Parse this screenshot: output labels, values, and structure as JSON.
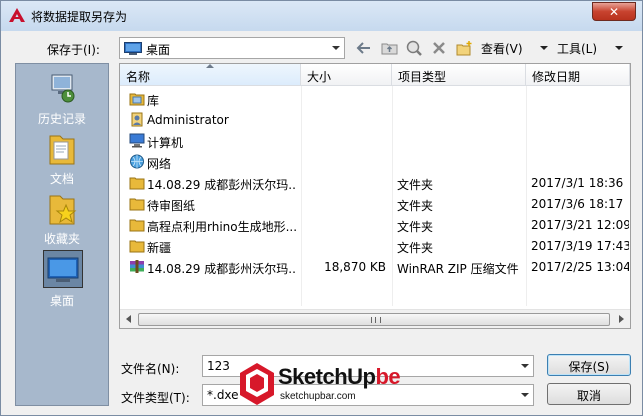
{
  "window": {
    "title": "将数据提取另存为",
    "close_label": "✕"
  },
  "location": {
    "label": "保存于(I):",
    "value": "桌面"
  },
  "toolbar": {
    "view_label": "查看(V)",
    "tools_label": "工具(L)"
  },
  "places": [
    {
      "label": "历史记录",
      "icon": "history-icon"
    },
    {
      "label": "文档",
      "icon": "documents-folder-icon"
    },
    {
      "label": "收藏夹",
      "icon": "favorites-folder-icon"
    },
    {
      "label": "桌面",
      "icon": "desktop-icon",
      "selected": true
    }
  ],
  "columns": [
    "名称",
    "大小",
    "项目类型",
    "修改日期"
  ],
  "files": [
    {
      "name": "库",
      "size": "",
      "type": "",
      "date": "",
      "icon": "library-icon"
    },
    {
      "name": "Administrator",
      "size": "",
      "type": "",
      "date": "",
      "icon": "user-icon"
    },
    {
      "name": "计算机",
      "size": "",
      "type": "",
      "date": "",
      "icon": "computer-icon"
    },
    {
      "name": "网络",
      "size": "",
      "type": "",
      "date": "",
      "icon": "network-icon"
    },
    {
      "name": "14.08.29 成都彭州沃尔玛...",
      "size": "",
      "type": "文件夹",
      "date": "2017/3/1 18:36",
      "icon": "folder-icon"
    },
    {
      "name": "待审图纸",
      "size": "",
      "type": "文件夹",
      "date": "2017/3/6 18:17",
      "icon": "folder-icon"
    },
    {
      "name": "高程点利用rhino生成地形...",
      "size": "",
      "type": "文件夹",
      "date": "2017/3/21 12:09",
      "icon": "folder-icon"
    },
    {
      "name": "新疆",
      "size": "",
      "type": "文件夹",
      "date": "2017/3/19 17:43",
      "icon": "folder-icon"
    },
    {
      "name": "14.08.29 成都彭州沃尔玛...",
      "size": "18,870 KB",
      "type": "WinRAR ZIP 压缩文件",
      "date": "2017/2/25 13:04",
      "icon": "archive-icon"
    }
  ],
  "filename": {
    "label": "文件名(N):",
    "value": "123"
  },
  "filetype": {
    "label": "文件类型(T):",
    "value": "*.dxe"
  },
  "buttons": {
    "save_label": "保存(S)",
    "cancel_label": "取消"
  },
  "watermark": {
    "brand_dark": "SketchUp",
    "brand_red": "be",
    "url": "sketchupbar.com"
  },
  "colors": {
    "title_bar": "#c6d9ee",
    "places_bg": "#a7b8cc",
    "close_red": "#c8432f",
    "folder_yellow": "#e8b93a",
    "watermark_red": "#d7182a"
  }
}
